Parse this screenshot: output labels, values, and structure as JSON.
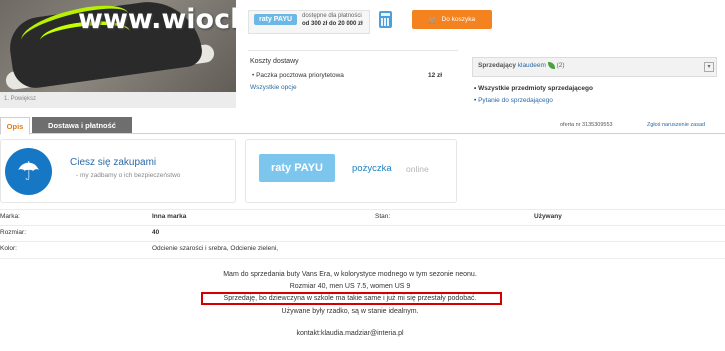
{
  "photo": {
    "watermark": "www.wiocha.pl",
    "caption": "1. Powiększ"
  },
  "payment": {
    "raty_badge": "raty PAYU",
    "info_line1": "dostępne dla płatności",
    "info_line2": "od 300 zł do 20 000 zł",
    "cart_button": "Do koszyka"
  },
  "shipping": {
    "title": "Koszty dostawy",
    "item_label": "Paczka pocztowa priorytetowa",
    "item_price": "12 zł",
    "link": "Wszystkie opcje"
  },
  "seller": {
    "label": "Sprzedający",
    "name": "klaudeem",
    "rating": "(2)",
    "all_items": "Wszystkie przedmioty sprzedającego",
    "ask_link": "Pytanie do sprzedającego"
  },
  "tabs": [
    {
      "label": "Opis"
    },
    {
      "label": "Dostawa i płatność"
    }
  ],
  "offer": {
    "number": "oferta nr 3135309553",
    "report": "Zgłoś naruszenie zasad"
  },
  "promo": {
    "title": "Ciesz się zakupami",
    "subtitle": "- my zadbamy o ich bezpieczeństwo",
    "payu_logo": "raty PAYU",
    "loan": "pożyczka",
    "online": "online"
  },
  "details": {
    "rows": [
      {
        "label": "Marka:",
        "value": "Inna marka",
        "label2": "Stan:",
        "value2": "Używany"
      },
      {
        "label": "Rozmiar:",
        "value": "40"
      },
      {
        "label": "Kolor:",
        "value": "Odcienie szarości i srebra, Odcienie zieleni,"
      }
    ]
  },
  "description": {
    "line1": "Mam do sprzedania buty Vans Era, w kolorystyce modnego w tym sezonie neonu.",
    "line2": "Rozmiar 40, men US 7.5, women US 9",
    "line3": "Sprzedaję, bo dziewczyna w szkole ma takie same i już mi się przestały podobać.",
    "line4": "Używane były rzadko, są w stanie idealnym.",
    "contact": "kontakt:klaudia.madziar@interia.pl"
  },
  "colors": {
    "accent_orange": "#f4821f",
    "link_blue": "#2b6aa6",
    "highlight_red": "#d40000",
    "payu_blue": "#7cc6ee"
  }
}
